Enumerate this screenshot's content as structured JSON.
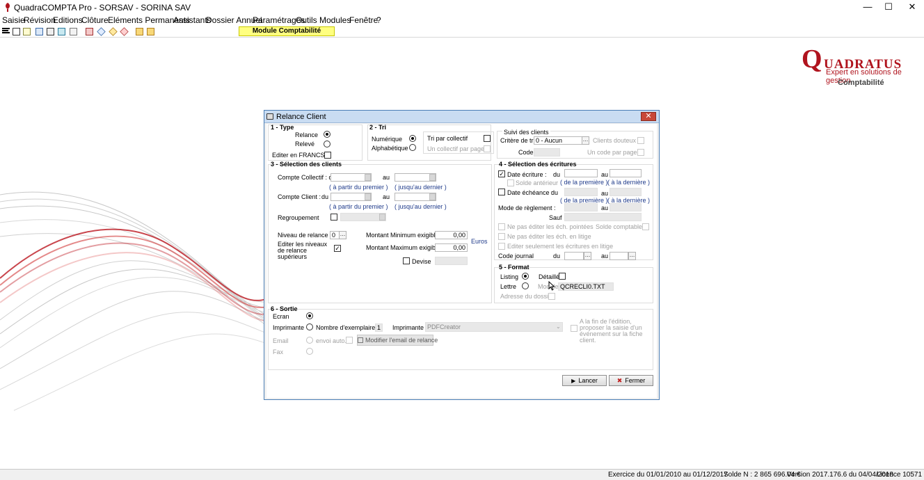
{
  "window": {
    "title": "QuadraCOMPTA Pro - SORSAV - SORINA SAV"
  },
  "menu": [
    "Saisie",
    "Révision",
    "Editions",
    "Clôture",
    "Eléments Permanents",
    "Assistants",
    "Dossier Annuel",
    "Paramétrages",
    "Outils",
    "Modules",
    "Fenêtre",
    "?"
  ],
  "toolbar": {
    "module_label": "Module Comptabilité"
  },
  "logo": {
    "q": "Q",
    "rest": "UADRATUS",
    "tagline": "Expert en solutions de gestion",
    "product": "Comptabilité"
  },
  "dialog": {
    "title": "Relance Client",
    "close": "✕",
    "type": {
      "heading": "1 - Type",
      "relance": "Relance",
      "releve": "Relevé",
      "francs": "Editer en FRANCS :"
    },
    "tri": {
      "heading": "2 - Tri",
      "numerique": "Numérique",
      "alphabetique": "Alphabétique",
      "tri_collectif": "Tri par collectif",
      "un_collectif_page": "Un collectif par page"
    },
    "suivi": {
      "heading": "Suivi des clients",
      "critere": "Critère de tri",
      "critere_value": "0 - Aucun",
      "clients_douteux": "Clients douteux",
      "code": "Code",
      "un_code_page": "Un code par page"
    },
    "selection_clients": {
      "heading": "3 - Sélection des clients",
      "compte_collectif": "Compte Collectif : du",
      "au": "au",
      "from_first": "( à partir du premier )",
      "to_last": "( jusqu'au dernier )",
      "compte_client": "Compte Client :",
      "du": "du",
      "regroupement": "Regroupement",
      "niveau_relance": "Niveau de relance",
      "niveau_value": "0",
      "editer_niveaux": "Editer les niveaux de relance supérieurs",
      "montant_min": "Montant Minimum exigible",
      "montant_min_value": "0,00",
      "montant_max": "Montant Maximum exigible",
      "montant_max_value": "0,00",
      "euros": "Euros",
      "devise": "Devise"
    },
    "selection_ecritures": {
      "heading": "4 - Sélection des écritures",
      "date_ecriture": "Date écriture :",
      "du": "du",
      "au": "au",
      "solde_anterieur": "Solde antérieur",
      "de_la_premiere": "( de la première )",
      "a_la_derniere": "( à la dernière )",
      "date_echeance": "Date échéance :",
      "mode_reglement": "Mode de règlement :",
      "sauf": "Sauf",
      "pointees": "Ne pas éditer les éch. pointées",
      "solde_comptable": "Solde comptable",
      "litige": "Ne pas éditer les éch. en litige",
      "seulement_litige": "Editer seulement les écritures en litige",
      "code_journal": "Code journal"
    },
    "format": {
      "heading": "5 - Format",
      "listing": "Listing",
      "detaille": "Détaillé",
      "lettre": "Lettre",
      "modele": "Modèle",
      "modele_value": "QCRECLI0.TXT",
      "adresse": "Adresse du dossier"
    },
    "sortie": {
      "heading": "6 - Sortie",
      "ecran": "Ecran",
      "imprimante": "Imprimante",
      "nb_exemplaires": "Nombre d'exemplaires",
      "nb_value": "1",
      "imprimante2": "Imprimante",
      "printer_value": "PDFCreator",
      "email": "Email",
      "envoi_auto": "envoi auto.",
      "modifier_email": "Modifier l'email de relance",
      "fax": "Fax",
      "fin_edition": "A la fin de l'édition, proposer la saisie d'un événement sur la fiche client."
    },
    "buttons": {
      "lancer": "Lancer",
      "fermer": "Fermer"
    }
  },
  "status": {
    "exercice": "Exercice du 01/01/2010 au 01/12/2017",
    "solde": "Solde N : 2 865 696.04 €",
    "version": "Version 2017.176.6 du 04/04/2018",
    "licence": "Licence 10571"
  }
}
